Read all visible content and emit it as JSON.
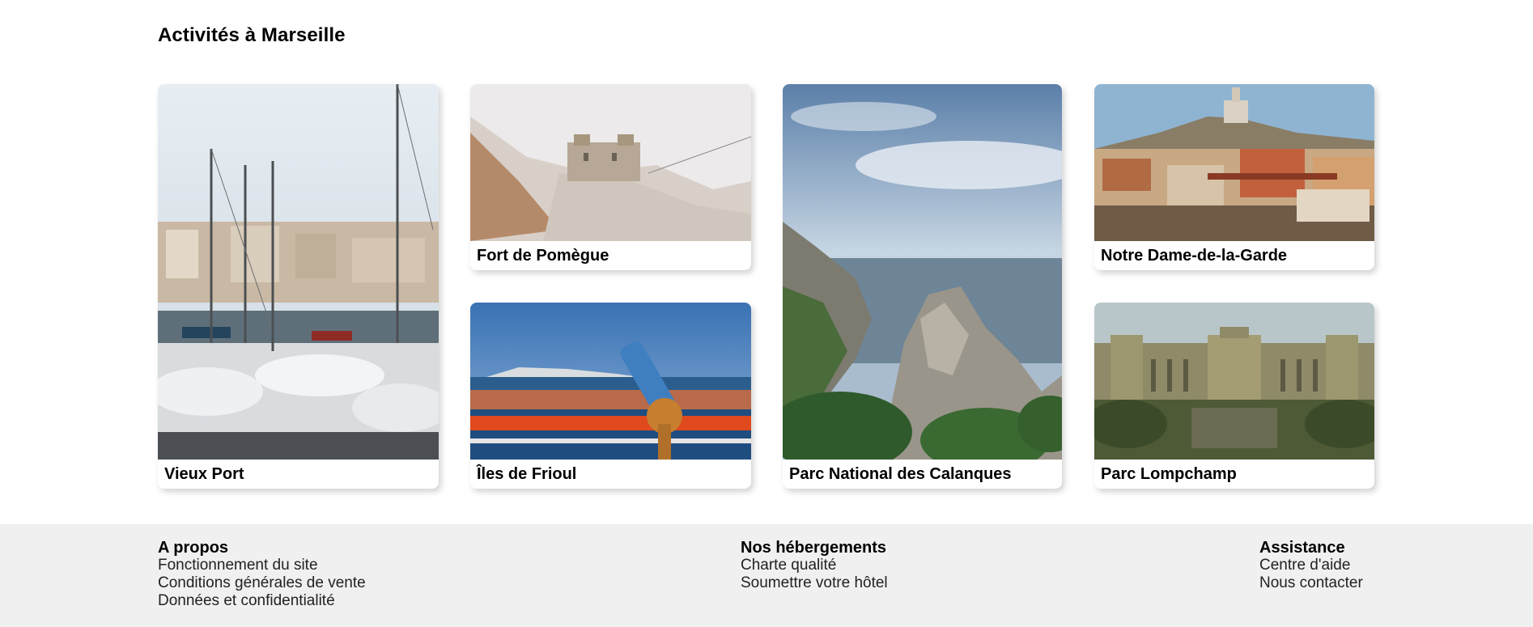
{
  "section": {
    "title": "Activités à Marseille"
  },
  "cards": [
    {
      "label": "Vieux Port"
    },
    {
      "label": "Fort de Pomègue"
    },
    {
      "label": "Îles de Frioul"
    },
    {
      "label": "Parc National des Calanques"
    },
    {
      "label": "Notre Dame-de-la-Garde"
    },
    {
      "label": "Parc Lompchamp"
    }
  ],
  "footer": {
    "about": {
      "heading": "A propos",
      "links": [
        "Fonctionnement du site",
        "Conditions générales de vente",
        "Données et confidentialité"
      ]
    },
    "lodging": {
      "heading": "Nos hébergements",
      "links": [
        "Charte qualité",
        "Soumettre votre hôtel"
      ]
    },
    "help": {
      "heading": "Assistance",
      "links": [
        "Centre d'aide",
        "Nous contacter"
      ]
    }
  },
  "colors": {
    "footer_bg": "#f0f0f0",
    "card_bg": "#ffffff",
    "text": "#000000"
  }
}
